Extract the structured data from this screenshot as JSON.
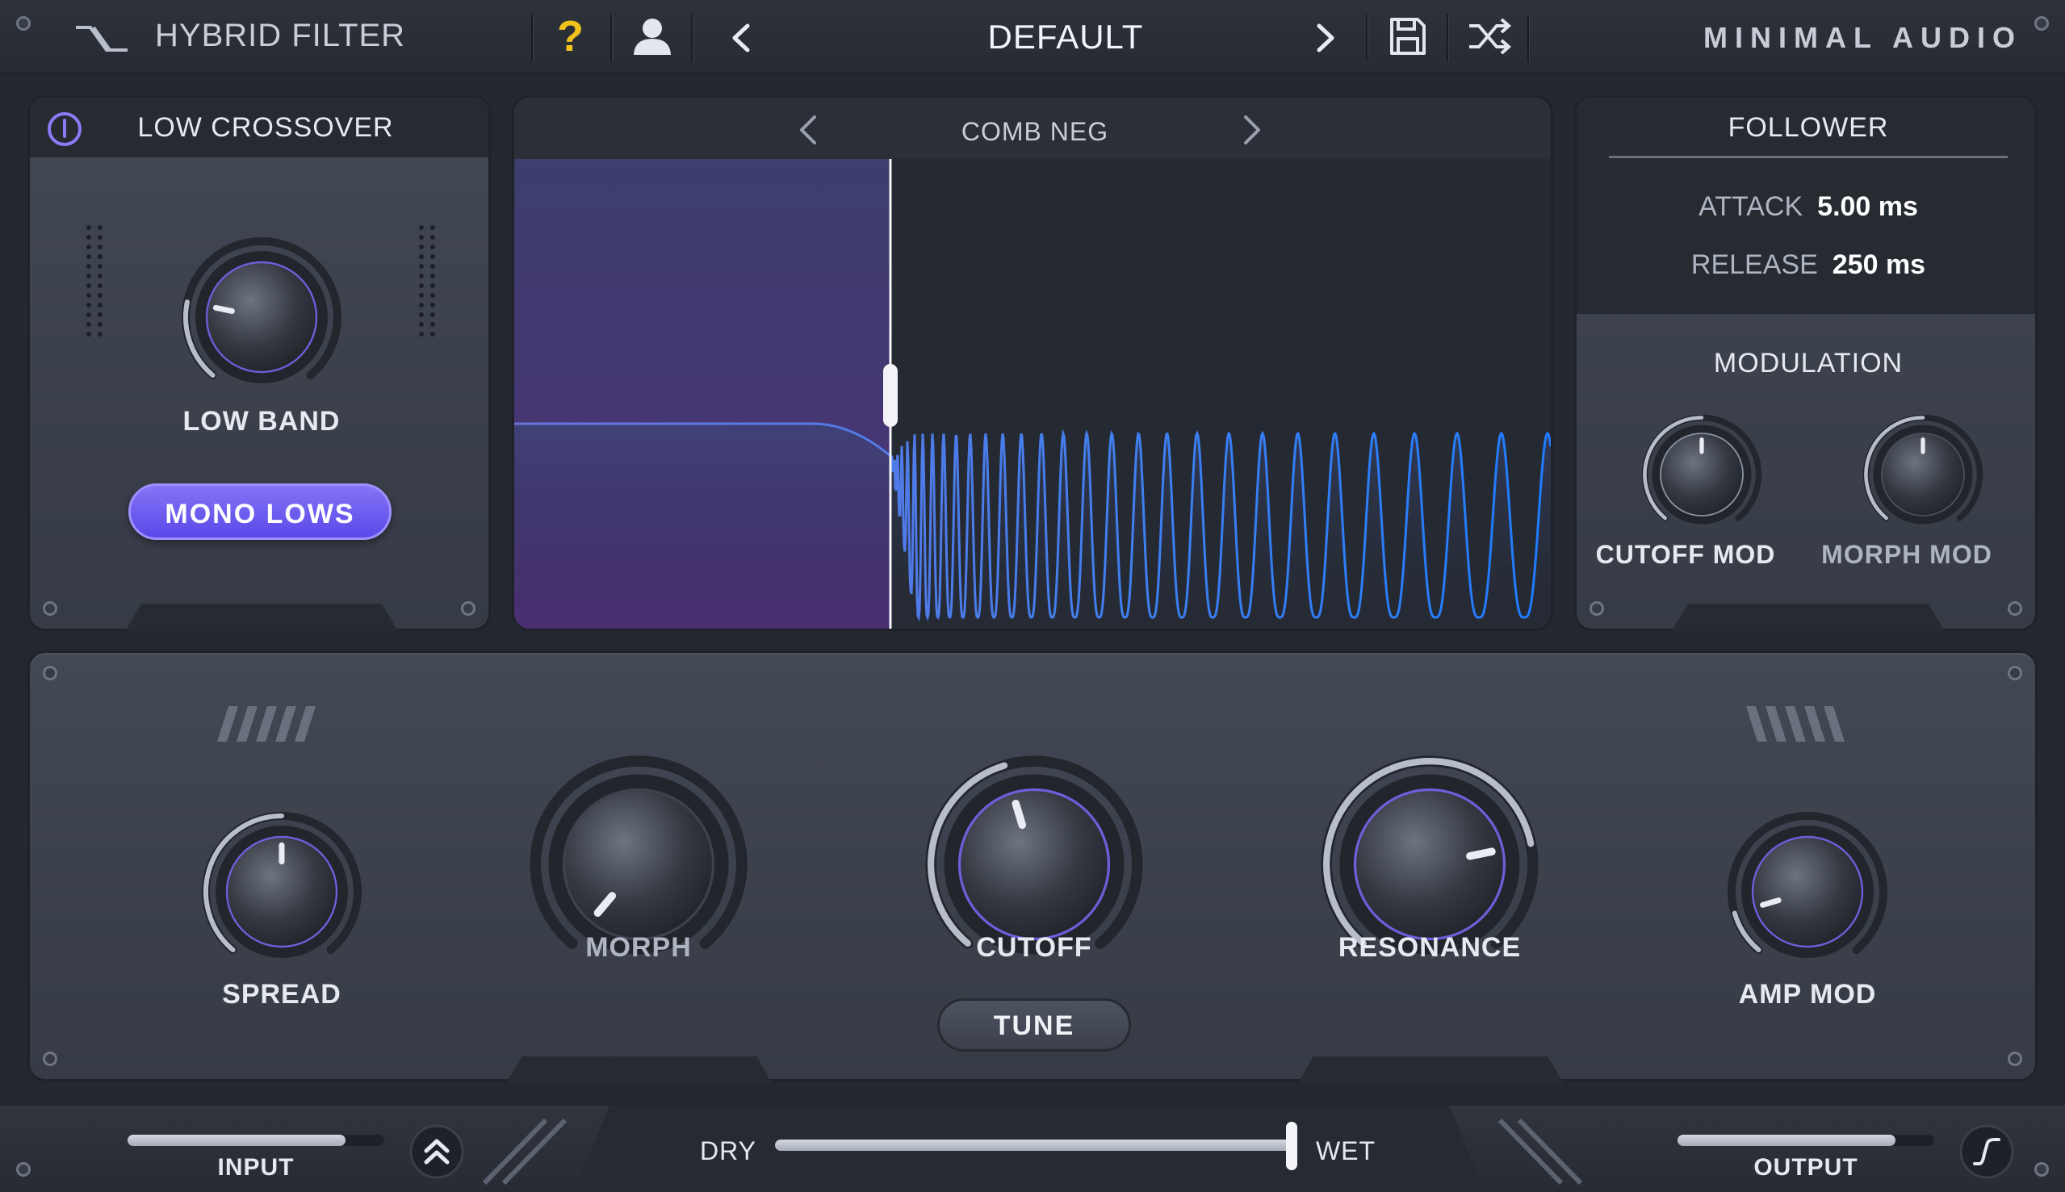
{
  "header": {
    "plugin_name": "HYBRID FILTER",
    "help_symbol": "?",
    "preset_name": "DEFAULT",
    "brand": "MINIMAL AUDIO",
    "icons": [
      "logo-icon",
      "help-icon",
      "user-icon",
      "chevron-left-icon",
      "chevron-right-icon",
      "save-icon",
      "shuffle-icon"
    ]
  },
  "low_crossover": {
    "title": "LOW CROSSOVER",
    "knob_label": "LOW BAND",
    "knob_level": 0.22,
    "button_label": "MONO LOWS",
    "accent": "#6c5cf0"
  },
  "display": {
    "filter_type": "COMB NEG",
    "region_color": "#4a3f8c",
    "curve_color": "#2f7cf5"
  },
  "follower": {
    "title": "FOLLOWER",
    "attack_label": "ATTACK",
    "attack_value": "5.00 ms",
    "release_label": "RELEASE",
    "release_value": "250 ms"
  },
  "modulation": {
    "title": "MODULATION",
    "cutoff_mod_label": "CUTOFF MOD",
    "cutoff_mod_level": 0.5,
    "morph_mod_label": "MORPH MOD",
    "morph_mod_level": 0.5
  },
  "main": {
    "spread_label": "SPREAD",
    "spread_level": 0.5,
    "morph_label": "MORPH",
    "morph_level": 0.0,
    "cutoff_label": "CUTOFF",
    "cutoff_level": 0.44,
    "resonance_label": "RESONANCE",
    "resonance_level": 0.78,
    "tune_label": "TUNE",
    "amp_mod_label": "AMP MOD",
    "amp_mod_level": 0.12
  },
  "bottom": {
    "input_label": "INPUT",
    "input_level": 0.85,
    "dry_label": "DRY",
    "wet_label": "WET",
    "mix_level": 1.0,
    "output_label": "OUTPUT",
    "output_level": 0.85
  }
}
